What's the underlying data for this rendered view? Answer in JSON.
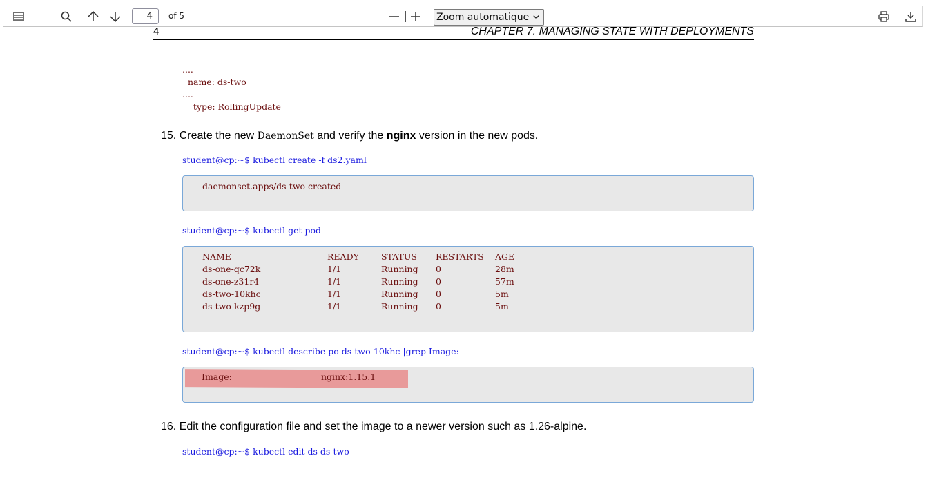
{
  "toolbar": {
    "page_current": "4",
    "page_of": "of 5",
    "zoom": "Zoom automatique",
    "icons": [
      "sidebar-icon",
      "search-icon",
      "arrow-up-icon",
      "arrow-down-icon",
      "minus-icon",
      "plus-icon",
      "print-icon",
      "download-icon"
    ]
  },
  "page": {
    "number": "4",
    "chapter": "CHAPTER 7.  MANAGING STATE WITH DEPLOYMENTS"
  },
  "yaml_snippet": [
    "....",
    "  name: ds-two",
    "....",
    "    type: RollingUpdate"
  ],
  "step15": {
    "num": "15.",
    "text_a": "Create the new ",
    "code": "DaemonSet",
    "text_b": " and verify the ",
    "bold": "nginx",
    "text_c": " version in the new pods."
  },
  "cmd1": "student@cp:~$ kubectl create -f ds2.yaml",
  "out1": "daemonset.apps/ds-two created",
  "cmd2": "student@cp:~$ kubectl get pod",
  "pods": {
    "headers": [
      "NAME",
      "READY",
      "STATUS",
      "RESTARTS",
      "AGE"
    ],
    "rows": [
      [
        "ds-one-qc72k",
        "1/1",
        "Running",
        "0",
        "28m"
      ],
      [
        "ds-one-z31r4",
        "1/1",
        "Running",
        "0",
        "57m"
      ],
      [
        "ds-two-10khc",
        "1/1",
        "Running",
        "0",
        "5m"
      ],
      [
        "ds-two-kzp9g",
        "1/1",
        "Running",
        "0",
        "5m"
      ]
    ]
  },
  "cmd3": "student@cp:~$ kubectl describe po ds-two-10khc |grep Image:",
  "out3": {
    "label": "Image:",
    "value": "nginx:1.15.1"
  },
  "step16": {
    "num": "16.",
    "text": "Edit the configuration file and set the image to a newer version such as 1.26-alpine."
  },
  "cmd4": "student@cp:~$ kubectl edit ds ds-two"
}
